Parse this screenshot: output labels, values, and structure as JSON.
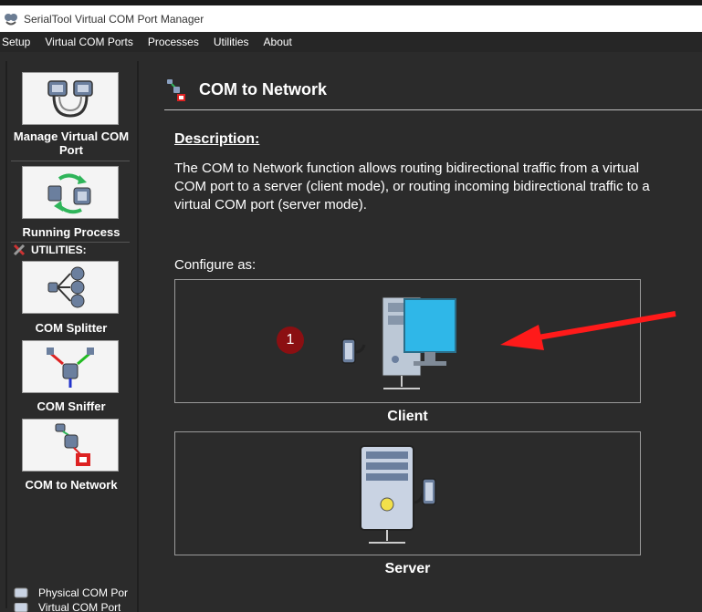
{
  "window": {
    "title": "SerialTool Virtual COM Port Manager"
  },
  "menu": [
    {
      "label": "Setup"
    },
    {
      "label": "Virtual COM Ports"
    },
    {
      "label": "Processes"
    },
    {
      "label": "Utilities"
    },
    {
      "label": "About"
    }
  ],
  "sidebar": {
    "manage_label": "Manage Virtual COM Port",
    "running_label": "Running Process",
    "utilities_header": "UTILITIES:",
    "splitter_label": "COM Splitter",
    "sniffer_label": "COM Sniffer",
    "network_label": "COM to Network",
    "bottom_items": [
      {
        "label": "Physical COM Por"
      },
      {
        "label": "Virtual COM Port"
      }
    ]
  },
  "main": {
    "title": "COM to Network",
    "description_title": "Description:",
    "description": "The COM to Network function allows routing bidirectional traffic from a virtual COM port to a server (client mode), or routing incoming bidirectional traffic to a virtual COM port (server mode).",
    "configure_label": "Configure as:",
    "client_label": "Client",
    "server_label": "Server",
    "badge": "1"
  },
  "colors": {
    "background": "#2b2b2b",
    "badge": "#8b0f12",
    "arrow": "#ff1a1a"
  }
}
